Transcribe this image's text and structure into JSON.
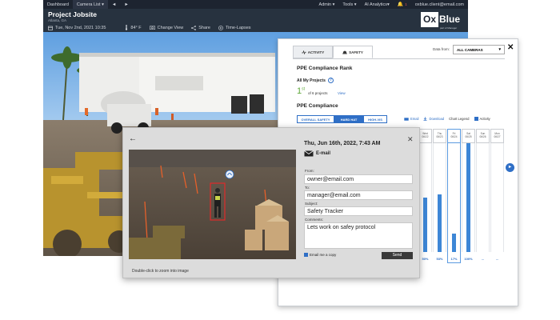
{
  "topnav": {
    "items": [
      "Dashboard",
      "Camera List ▾",
      "◄",
      "►"
    ],
    "right": [
      "Admin ▾",
      "Tools ▾",
      "AI Analytics▾"
    ],
    "notification_count": "1",
    "user": "oxblue.client@email.com"
  },
  "header": {
    "title": "Project Jobsite",
    "location": "Atlanta, GA",
    "date": "Tue, Nov 2nd, 2021 10:35",
    "temp": "84° F",
    "change_view": "Change View",
    "share": "Share",
    "timelapses": "Time-Lapses"
  },
  "logo": {
    "ox": "Ox",
    "blue": "Blue",
    "sub": "part of Manager"
  },
  "panel": {
    "tab_activity": "ACTIVITY",
    "tab_safety": "SAFETY",
    "data_from_label": "Data from:",
    "data_from_value": "ALL CAMERAS",
    "rank_title": "PPE Compliance Rank",
    "all_projects": "All My Projects",
    "rank_num": "1",
    "rank_sup": "st",
    "rank_of": "of 6 projects",
    "view": "View",
    "compliance_title": "PPE Compliance",
    "seg_overall": "OVERALL SAFETY",
    "seg_hard_hat": "HARD HAT",
    "seg_hi_vis": "HIGH-VIS",
    "email": "Email",
    "download": "Download",
    "legend": "Chart Legend",
    "activity": "Activity"
  },
  "chart_data": {
    "type": "bar",
    "categories": [
      "Wed 06/22",
      "Thu 06/23",
      "Fri 06/24",
      "Sat 06/25",
      "Sun 06/26",
      "Mon 06/27"
    ],
    "series": [
      {
        "values": [
          50,
          53,
          17,
          100,
          0,
          0
        ]
      }
    ],
    "labels": [
      "50%",
      "53%",
      "17%",
      "100%",
      "--",
      "--"
    ],
    "highlight": "Fri 06/24",
    "ylim": [
      0,
      100
    ]
  },
  "dialog": {
    "datetime": "Thu, Jun 16th, 2022, 7:43 AM",
    "channel": "E-mail",
    "from_label": "From:",
    "from_value": "owner@email.com",
    "to_label": "To:",
    "to_value": "manager@email.com",
    "subject_label": "Subject:",
    "subject_value": "Safety Tracker",
    "comments_label": "Comments:",
    "comments_value": "Lets work on safey protocol",
    "email_copy": "Email me a copy",
    "send": "Send",
    "hint": "Double-click to zoom into image"
  }
}
